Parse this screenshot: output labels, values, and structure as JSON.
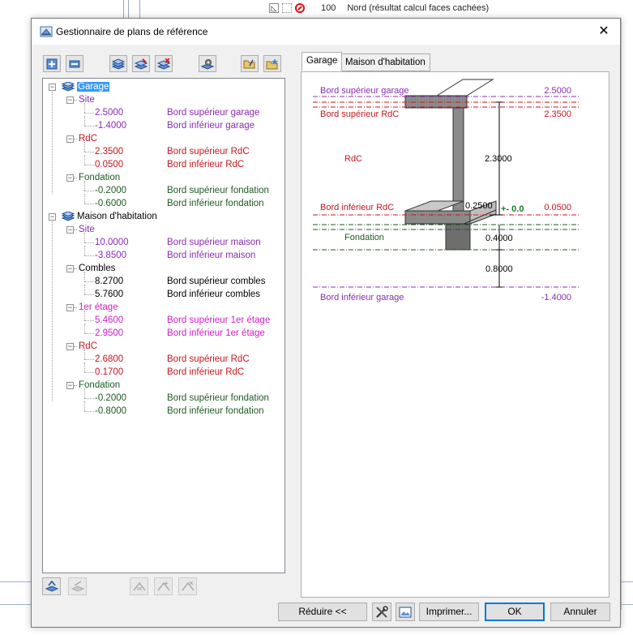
{
  "background": {
    "row_number": "100",
    "row_text": "Nord (résultat calcul faces cachées)"
  },
  "dialog": {
    "title": "Gestionnaire de plans de référence",
    "close_label": "✕"
  },
  "tree": {
    "nodes": [
      {
        "label": "Garage",
        "kind": "project",
        "selected": true
      },
      {
        "label": "Site",
        "kind": "level",
        "color": "#8b2bb5"
      },
      {
        "value": "2.5000",
        "label": "Bord supérieur garage",
        "color": "#8b2bb5"
      },
      {
        "value": "-1.4000",
        "label": "Bord inférieur garage",
        "color": "#8b2bb5"
      },
      {
        "label": "RdC",
        "kind": "level",
        "color": "#c8161e"
      },
      {
        "value": "2.3500",
        "label": "Bord supérieur RdC",
        "color": "#c8161e"
      },
      {
        "value": "0.0500",
        "label": "Bord inférieur RdC",
        "color": "#c8161e"
      },
      {
        "label": "Fondation",
        "kind": "level",
        "color": "#1f5b1f"
      },
      {
        "value": "-0.2000",
        "label": "Bord supérieur fondation",
        "color": "#1f5b1f"
      },
      {
        "value": "-0.6000",
        "label": "Bord inférieur fondation",
        "color": "#1f5b1f"
      },
      {
        "label": "Maison d'habitation",
        "kind": "project"
      },
      {
        "label": "Site",
        "kind": "level",
        "color": "#8b2bb5"
      },
      {
        "value": "10.0000",
        "label": "Bord supérieur maison",
        "color": "#8b2bb5"
      },
      {
        "value": "-3.8500",
        "label": "Bord inférieur maison",
        "color": "#8b2bb5"
      },
      {
        "label": "Combles",
        "kind": "level",
        "color": "#000000"
      },
      {
        "value": "8.2700",
        "label": "Bord supérieur combles",
        "color": "#000000"
      },
      {
        "value": "5.7600",
        "label": "Bord inférieur combles",
        "color": "#000000"
      },
      {
        "label": "1er étage",
        "kind": "level",
        "color": "#d21cc8"
      },
      {
        "value": "5.4600",
        "label": "Bord supérieur 1er étage",
        "color": "#d21cc8"
      },
      {
        "value": "2.9500",
        "label": "Bord inférieur 1er étage",
        "color": "#d21cc8"
      },
      {
        "label": "RdC",
        "kind": "level",
        "color": "#c8161e"
      },
      {
        "value": "2.6800",
        "label": "Bord supérieur RdC",
        "color": "#c8161e"
      },
      {
        "value": "0.1700",
        "label": "Bord inférieur RdC",
        "color": "#c8161e"
      },
      {
        "label": "Fondation",
        "kind": "level",
        "color": "#1f5b1f"
      },
      {
        "value": "-0.2000",
        "label": "Bord supérieur fondation",
        "color": "#1f5b1f"
      },
      {
        "value": "-0.8000",
        "label": "Bord inférieur fondation",
        "color": "#1f5b1f"
      }
    ]
  },
  "toolbar": {
    "icons": [
      "add-plane-icon",
      "remove-plane-icon",
      "layers-icon",
      "layers-edit-icon",
      "layers-delete-icon",
      "layer-settings-icon",
      "open-folder-icon",
      "favorite-folder-icon"
    ]
  },
  "bottom_toolbar": {
    "icons": [
      "assign-layer-icon",
      "unassign-layer-icon",
      "roof-edit-icon",
      "roof-add-icon",
      "roof-delete-icon"
    ]
  },
  "tabs": [
    "Garage",
    "Maison d'habitation"
  ],
  "diagram": {
    "top_edge_label": "Bord supérieur garage",
    "top_edge_value": "2.5000",
    "rdc_top_label": "Bord supérieur RdC",
    "rdc_top_value": "2.3500",
    "level_label": "RdC",
    "height_value": "2.3000",
    "rdc_bottom_label": "Bord inférieur RdC",
    "slab_value": "0.2500",
    "zero_mark": "+- 0.0",
    "rdc_bottom_value": "0.0500",
    "foundation_label": "Fondation",
    "foundation_value": "0.4000",
    "lower_value": "0.8000",
    "bottom_edge_label": "Bord inférieur garage",
    "bottom_edge_value": "-1.4000",
    "colors": {
      "site": "#8b2bb5",
      "rdc": "#c8161e",
      "foundation": "#1f5b1f",
      "wall": "#7f7f7f",
      "zero": "#1a7a2a"
    }
  },
  "buttons": {
    "reduce": "Réduire <<",
    "print": "Imprimer...",
    "ok": "OK",
    "cancel": "Annuler",
    "tools_icon": "tools-icon",
    "preview_icon": "image-export-icon"
  }
}
